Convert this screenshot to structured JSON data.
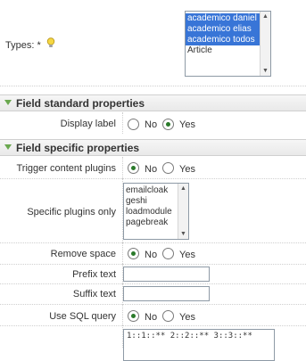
{
  "types": {
    "label": "Types: *",
    "options": [
      {
        "label": "academico daniel",
        "selected": true
      },
      {
        "label": "academico elias",
        "selected": true
      },
      {
        "label": "academico todos",
        "selected": true
      },
      {
        "label": "Article",
        "selected": false
      }
    ]
  },
  "sections": {
    "standard": "Field standard properties",
    "specific": "Field specific properties"
  },
  "display_label": {
    "label": "Display label",
    "no": "No",
    "yes": "Yes",
    "value": "Yes"
  },
  "trigger_plugins": {
    "label": "Trigger content plugins",
    "no": "No",
    "yes": "Yes",
    "value": "No"
  },
  "specific_plugins": {
    "label": "Specific plugins only",
    "options": [
      "emailcloak",
      "geshi",
      "loadmodule",
      "pagebreak"
    ]
  },
  "remove_space": {
    "label": "Remove space",
    "no": "No",
    "yes": "Yes",
    "value": "No"
  },
  "prefix_text": {
    "label": "Prefix text",
    "value": ""
  },
  "suffix_text": {
    "label": "Suffix text",
    "value": ""
  },
  "use_sql": {
    "label": "Use SQL query",
    "no": "No",
    "yes": "Yes",
    "value": "No"
  },
  "sql_value": "1::1::** 2::2::** 3::3::**",
  "colors": {
    "selected_bg": "#3875d7",
    "radio_dot": "#2a7a2a",
    "section_triangle": "#6aa84f"
  }
}
